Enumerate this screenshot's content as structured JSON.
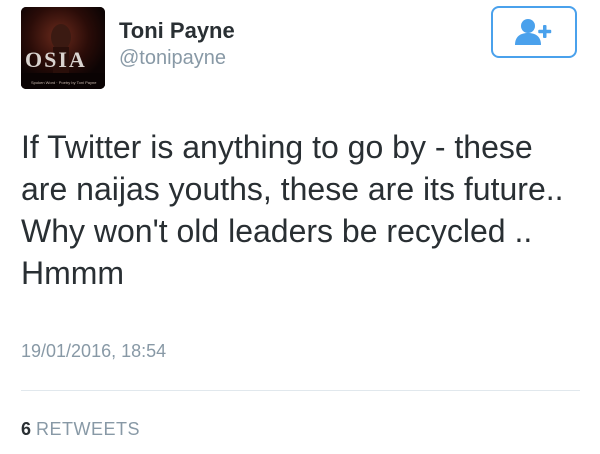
{
  "author": {
    "name": "Toni Payne",
    "handle": "@tonipayne",
    "avatar": {
      "icon": "profile-photo",
      "overlay_text": "OSIA",
      "caption": "Spoken Word · Poetry by Toni Payne"
    }
  },
  "follow_button": {
    "icon": "follow-user-plus-icon",
    "color": "#4aa1ec"
  },
  "tweet": {
    "text": "If Twitter is anything to go by - these are naijas youths, these are its future.. Why won't old leaders be recycled .. Hmmm",
    "timestamp": "19/01/2016, 18:54"
  },
  "stats": {
    "retweets_count": "6",
    "retweets_label": "RETWEETS"
  },
  "colors": {
    "text": "#292f33",
    "secondary": "#8899a6",
    "accent": "#4aa1ec",
    "divider": "#e1e8ed"
  }
}
